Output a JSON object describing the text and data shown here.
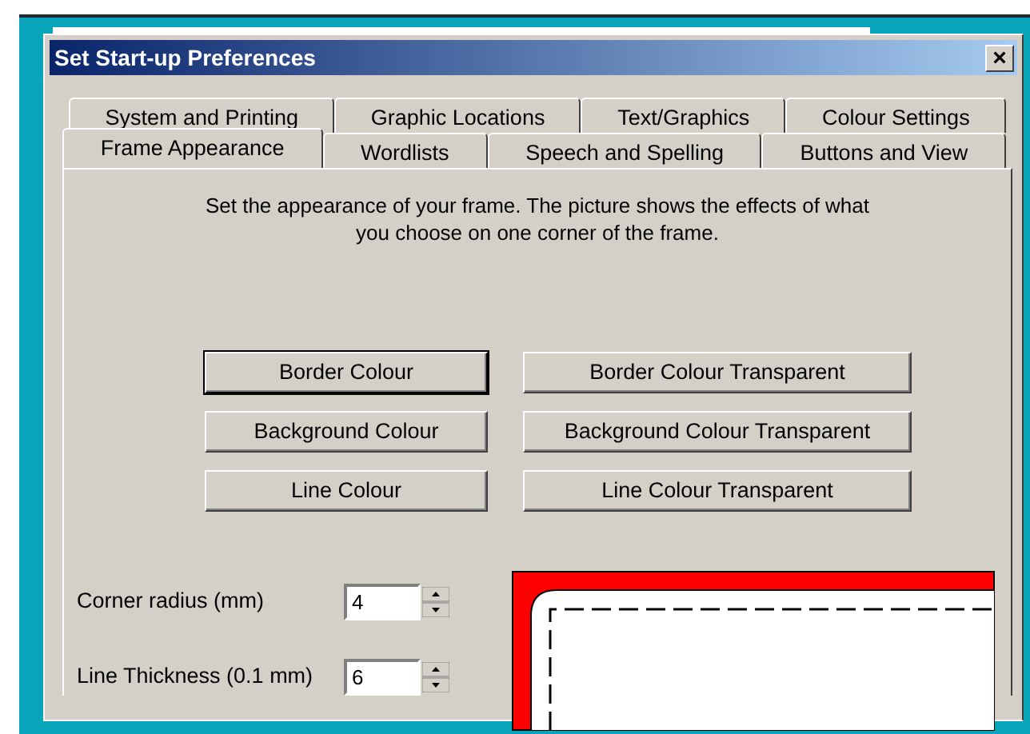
{
  "window": {
    "title": "Set Start-up Preferences",
    "close": "×"
  },
  "tab_rows": [
    {
      "tabs": [
        {
          "label": "System and Printing",
          "selected": false
        },
        {
          "label": "Graphic Locations",
          "selected": false
        },
        {
          "label": "Text/Graphics",
          "selected": false
        },
        {
          "label": "Colour Settings",
          "selected": false
        }
      ]
    },
    {
      "tabs": [
        {
          "label": "Frame Appearance",
          "selected": true
        },
        {
          "label": "Wordlists",
          "selected": false
        },
        {
          "label": "Speech and Spelling",
          "selected": false
        },
        {
          "label": "Buttons and View",
          "selected": false
        }
      ]
    }
  ],
  "description": "Set the appearance of your frame. The picture shows the effects of what you choose on one corner of the frame.",
  "buttons": [
    {
      "label": "Border Colour",
      "default": true
    },
    {
      "label": "Border Colour Transparent",
      "default": false
    },
    {
      "label": "Background Colour",
      "default": false
    },
    {
      "label": "Background Colour Transparent",
      "default": false
    },
    {
      "label": "Line Colour",
      "default": false
    },
    {
      "label": "Line Colour Transparent",
      "default": false
    }
  ],
  "fields": [
    {
      "label": "Corner radius (mm)",
      "value": "4"
    },
    {
      "label": "Line Thickness (0.1 mm)",
      "value": "6"
    }
  ]
}
